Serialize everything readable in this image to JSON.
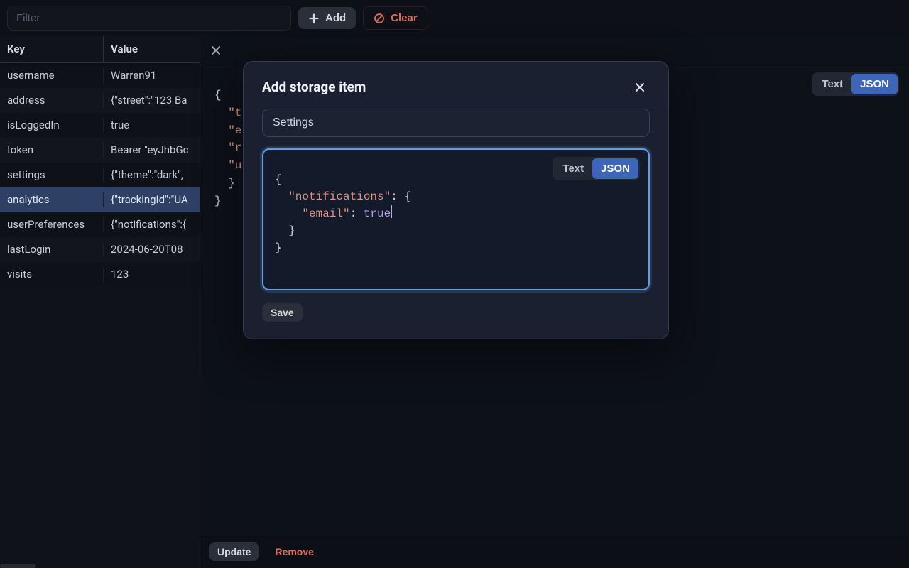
{
  "toolbar": {
    "filter_placeholder": "Filter",
    "add_label": "Add",
    "clear_label": "Clear"
  },
  "table": {
    "headers": {
      "key": "Key",
      "value": "Value"
    },
    "selected_index": 5,
    "rows": [
      {
        "key": "username",
        "value": "Warren91"
      },
      {
        "key": "address",
        "value": "{\"street\":\"123 Ba"
      },
      {
        "key": "isLoggedIn",
        "value": "true"
      },
      {
        "key": "token",
        "value": "Bearer \"eyJhbGc"
      },
      {
        "key": "settings",
        "value": "{\"theme\":\"dark\","
      },
      {
        "key": "analytics",
        "value": "{\"trackingId\":\"UA"
      },
      {
        "key": "userPreferences",
        "value": "{\"notifications\":{"
      },
      {
        "key": "lastLogin",
        "value": "2024-06-20T08"
      },
      {
        "key": "visits",
        "value": "123"
      }
    ]
  },
  "detail": {
    "toggle": {
      "text": "Text",
      "json": "JSON"
    },
    "code_lines": [
      {
        "indent": 0,
        "tokens": [
          {
            "t": "p",
            "s": "{"
          }
        ]
      },
      {
        "indent": 1,
        "tokens": [
          {
            "t": "k",
            "s": "\"t"
          }
        ]
      },
      {
        "indent": 1,
        "tokens": [
          {
            "t": "k",
            "s": "\"e"
          }
        ]
      },
      {
        "indent": 1,
        "tokens": [
          {
            "t": "k",
            "s": "\"r"
          }
        ]
      },
      {
        "indent": 1,
        "tokens": [
          {
            "t": "k",
            "s": "\"u"
          }
        ]
      },
      {
        "indent": 1,
        "tokens": [
          {
            "t": "p",
            "s": "}"
          }
        ]
      },
      {
        "indent": 0,
        "tokens": [
          {
            "t": "p",
            "s": "}"
          }
        ]
      }
    ],
    "footer": {
      "update": "Update",
      "remove": "Remove"
    }
  },
  "modal": {
    "title": "Add storage item",
    "key_value": "Settings",
    "toggle": {
      "text": "Text",
      "json": "JSON"
    },
    "editor_lines": [
      {
        "indent": 0,
        "tokens": [
          {
            "t": "p",
            "s": "{"
          }
        ]
      },
      {
        "indent": 1,
        "tokens": [
          {
            "t": "k",
            "s": "\"notifications\""
          },
          {
            "t": "p",
            "s": ": {"
          }
        ]
      },
      {
        "indent": 2,
        "tokens": [
          {
            "t": "k",
            "s": "\"email\""
          },
          {
            "t": "p",
            "s": ": "
          },
          {
            "t": "v",
            "s": "true"
          }
        ],
        "caret_after": true
      },
      {
        "indent": 1,
        "tokens": [
          {
            "t": "p",
            "s": "}"
          }
        ]
      },
      {
        "indent": 0,
        "tokens": [
          {
            "t": "p",
            "s": "}"
          }
        ]
      }
    ],
    "save": "Save"
  }
}
